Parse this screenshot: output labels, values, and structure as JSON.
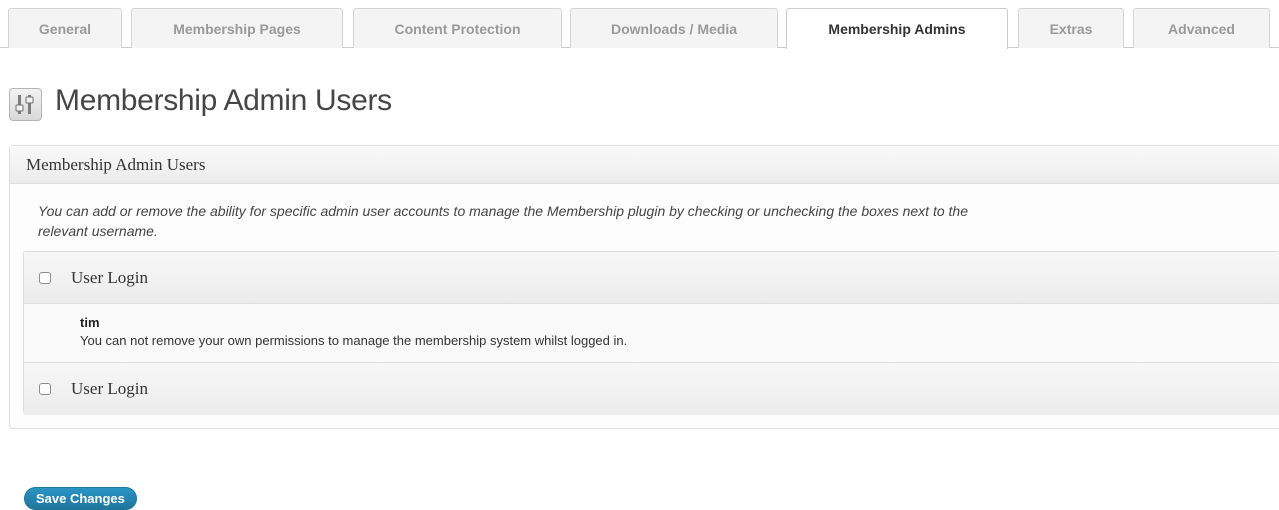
{
  "tabs": [
    {
      "label": "General"
    },
    {
      "label": "Membership Pages"
    },
    {
      "label": "Content Protection"
    },
    {
      "label": "Downloads / Media"
    },
    {
      "label": "Membership Admins",
      "active": true
    },
    {
      "label": "Extras"
    },
    {
      "label": "Advanced"
    }
  ],
  "page": {
    "title": "Membership Admin Users",
    "icon": "settings-sliders-icon"
  },
  "postbox": {
    "title": "Membership Admin Users",
    "description_line1": "You can add or remove the ability for specific admin user accounts to manage the Membership plugin by checking or unchecking the boxes next to the",
    "description_line2": "relevant username."
  },
  "table": {
    "header_label": "User Login",
    "footer_label": "User Login",
    "rows": [
      {
        "username": "tim",
        "note": "You can not remove your own permissions to manage the membership system whilst logged in."
      }
    ]
  },
  "actions": {
    "save_label": "Save Changes"
  },
  "colors": {
    "primary_button": "#21759b",
    "tab_border": "#cccccc"
  }
}
